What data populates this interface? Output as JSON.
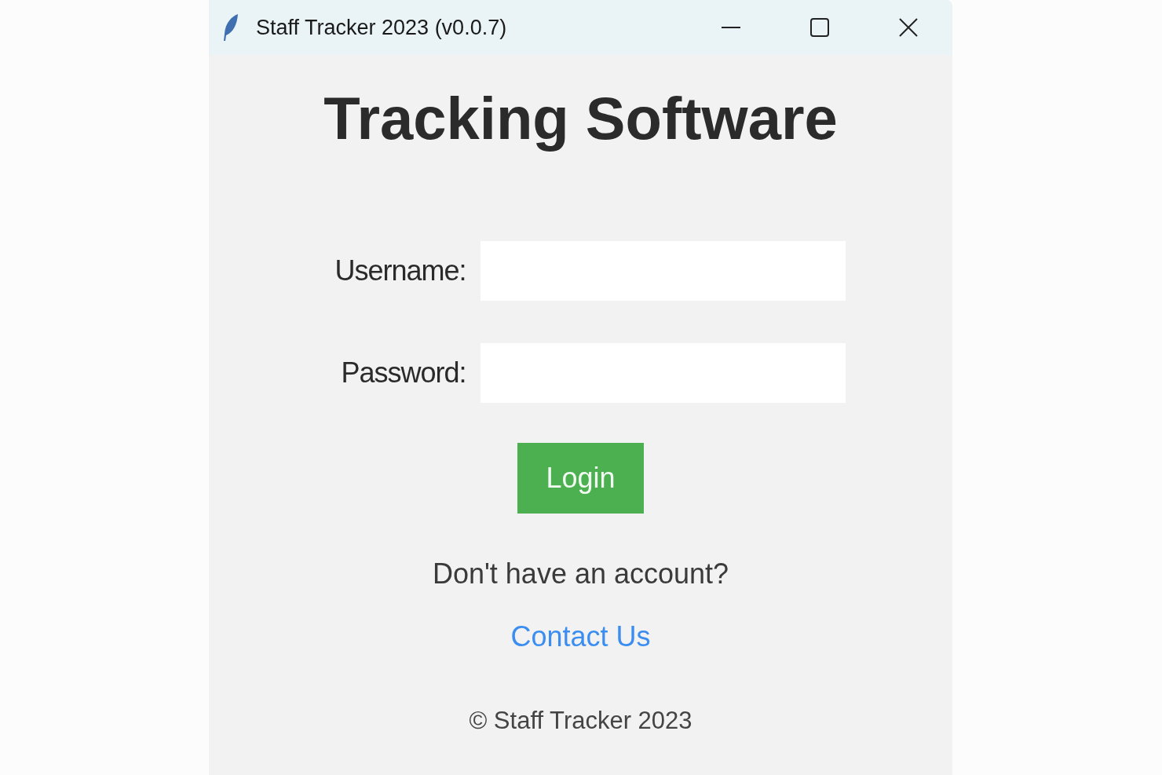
{
  "window": {
    "title": "Staff Tracker 2023 (v0.0.7)"
  },
  "heading": "Tracking Software",
  "form": {
    "fields": [
      {
        "label": "Username:"
      },
      {
        "label": "Password:"
      }
    ]
  },
  "login_button": "Login",
  "signup_prompt": "Don't have an account?",
  "contact_link": "Contact Us",
  "footer": "© Staff Tracker 2023"
}
